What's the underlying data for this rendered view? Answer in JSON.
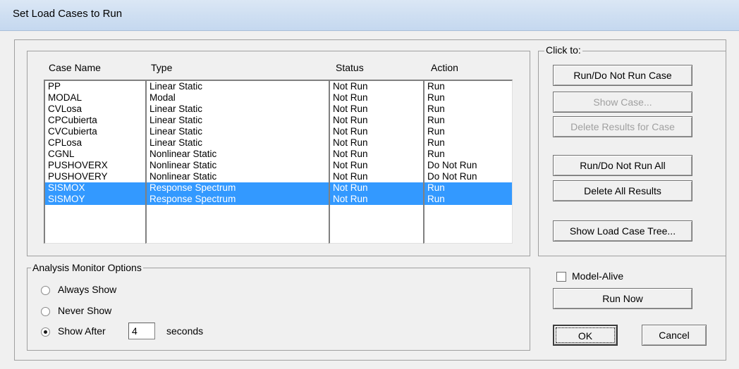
{
  "window": {
    "title": "Set Load Cases to Run"
  },
  "cases_table": {
    "columns": [
      "Case Name",
      "Type",
      "Status",
      "Action"
    ],
    "rows": [
      {
        "name": "PP",
        "type": "Linear Static",
        "status": "Not Run",
        "action": "Run",
        "selected": false
      },
      {
        "name": "MODAL",
        "type": "Modal",
        "status": "Not Run",
        "action": "Run",
        "selected": false
      },
      {
        "name": "CVLosa",
        "type": "Linear Static",
        "status": "Not Run",
        "action": "Run",
        "selected": false
      },
      {
        "name": "CPCubierta",
        "type": "Linear Static",
        "status": "Not Run",
        "action": "Run",
        "selected": false
      },
      {
        "name": "CVCubierta",
        "type": "Linear Static",
        "status": "Not Run",
        "action": "Run",
        "selected": false
      },
      {
        "name": "CPLosa",
        "type": "Linear Static",
        "status": "Not Run",
        "action": "Run",
        "selected": false
      },
      {
        "name": "CGNL",
        "type": "Nonlinear Static",
        "status": "Not Run",
        "action": "Run",
        "selected": false
      },
      {
        "name": "PUSHOVERX",
        "type": "Nonlinear Static",
        "status": "Not Run",
        "action": "Do Not Run",
        "selected": false
      },
      {
        "name": "PUSHOVERY",
        "type": "Nonlinear Static",
        "status": "Not Run",
        "action": "Do Not Run",
        "selected": false
      },
      {
        "name": "SISMOX",
        "type": "Response Spectrum",
        "status": "Not Run",
        "action": "Run",
        "selected": true
      },
      {
        "name": "SISMOY",
        "type": "Response Spectrum",
        "status": "Not Run",
        "action": "Run",
        "selected": true
      }
    ]
  },
  "click_to": {
    "label": "Click to:",
    "run_do_not_run_case": "Run/Do Not Run Case",
    "show_case": "Show Case...",
    "delete_results_for_case": "Delete Results for Case",
    "run_do_not_run_all": "Run/Do Not Run All",
    "delete_all_results": "Delete All Results",
    "show_load_case_tree": "Show Load Case Tree..."
  },
  "monitor_options": {
    "label": "Analysis Monitor Options",
    "always_show": "Always Show",
    "never_show": "Never Show",
    "show_after": "Show After",
    "seconds_value": "4",
    "seconds_label": "seconds",
    "selected": "show_after"
  },
  "model_alive": {
    "label": "Model-Alive",
    "checked": false
  },
  "run_now": "Run Now",
  "ok": "OK",
  "cancel": "Cancel"
}
